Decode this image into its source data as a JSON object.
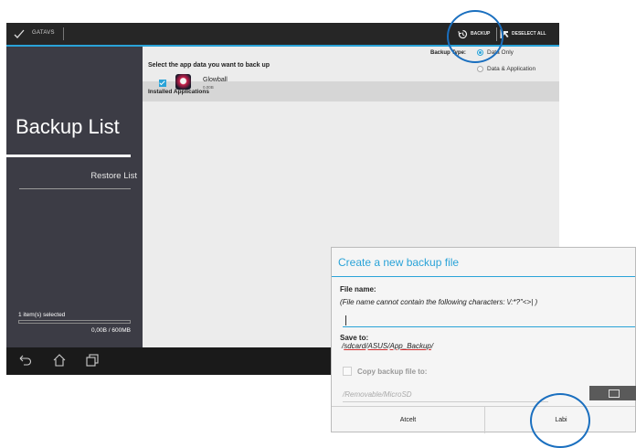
{
  "action_bar": {
    "title": "GATAVS",
    "backup_label": "BACKUP",
    "deselect_label": "DESELECT ALL",
    "icons": [
      "check-icon",
      "backup-icon",
      "deselect-icon"
    ]
  },
  "sidebar": {
    "title": "Backup List",
    "restore_label": "Restore List",
    "selected_text": "1 item(s) selected",
    "storage_text": "0,00B / 600MB",
    "storage_fraction": 0.0
  },
  "main": {
    "select_title": "Select the app data you want to back up",
    "backup_type_label": "Backup Type:",
    "options": [
      {
        "label": "Data Only",
        "selected": true
      },
      {
        "label": "Data & Application",
        "selected": false
      }
    ],
    "installed_header": "Installed Applications",
    "apps": [
      {
        "name": "Glowball",
        "size": "0,00B",
        "checked": true
      }
    ]
  },
  "navbar": {
    "icons": [
      "back-icon",
      "home-icon",
      "recent-apps-icon"
    ]
  },
  "dialog": {
    "title": "Create a new backup file",
    "file_name_label": "File name:",
    "file_name_note": "(File name cannot contain the following characters: \\/:*?\"<>| )",
    "file_name_value": "",
    "save_to_label": "Save to:",
    "save_path_parts": [
      "/",
      "sdcard",
      "/",
      "ASUS",
      "/",
      "App_Backup",
      "/"
    ],
    "copy_label": "Copy backup file to:",
    "copy_path": "/Removable/MicroSD",
    "cancel_label": "Atcelt",
    "ok_label": "Labi"
  },
  "colors": {
    "accent": "#2aa3d8",
    "sidebar": "#3c3c45",
    "action_bar": "#262626",
    "callout": "#1a6fbf"
  }
}
